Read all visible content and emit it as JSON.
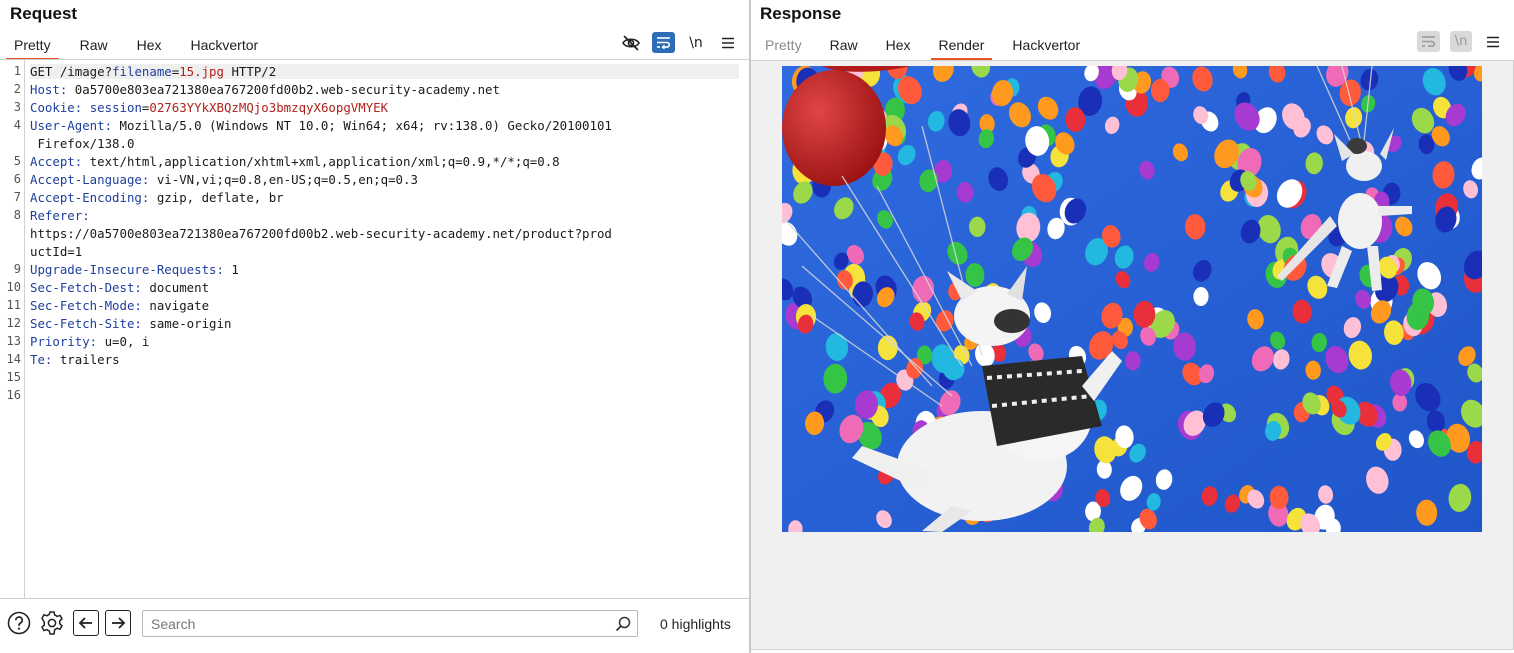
{
  "request": {
    "title": "Request",
    "tabs": [
      "Pretty",
      "Raw",
      "Hex",
      "Hackvertor"
    ],
    "active_tab": "Pretty",
    "icons": [
      "eye-off-icon",
      "wrap-lines-icon",
      "newline-icon",
      "menu-icon"
    ],
    "line_numbers": [
      "1",
      "2",
      "3",
      "4",
      "",
      "5",
      "6",
      "7",
      "8",
      "",
      "",
      "9",
      "10",
      "11",
      "12",
      "13",
      "14",
      "15",
      "16"
    ],
    "lines": [
      {
        "parts": [
          {
            "t": "GET /image?",
            "c": ""
          },
          {
            "t": "filename",
            "c": "k"
          },
          {
            "t": "=",
            "c": ""
          },
          {
            "t": "15.jpg",
            "c": "v"
          },
          {
            "t": " HTTP/2",
            "c": ""
          }
        ]
      },
      {
        "parts": [
          {
            "t": "Host:",
            "c": "k"
          },
          {
            "t": " 0a5700e803ea721380ea767200fd00b2.web-security-academy.net",
            "c": ""
          }
        ]
      },
      {
        "parts": [
          {
            "t": "Cookie:",
            "c": "k"
          },
          {
            "t": " ",
            "c": ""
          },
          {
            "t": "session",
            "c": "k"
          },
          {
            "t": "=",
            "c": ""
          },
          {
            "t": "02763YYkXBQzMQjo3bmzqyX6opgVMYEK",
            "c": "v"
          }
        ]
      },
      {
        "parts": [
          {
            "t": "User-Agent:",
            "c": "k"
          },
          {
            "t": " Mozilla/5.0 (Windows NT 10.0; Win64; x64; rv:138.0) Gecko/20100101",
            "c": ""
          }
        ]
      },
      {
        "parts": [
          {
            "t": " Firefox/138.0",
            "c": ""
          }
        ]
      },
      {
        "parts": [
          {
            "t": "Accept:",
            "c": "k"
          },
          {
            "t": " text/html,application/xhtml+xml,application/xml;q=0.9,*/*;q=0.8",
            "c": ""
          }
        ]
      },
      {
        "parts": [
          {
            "t": "Accept-Language:",
            "c": "k"
          },
          {
            "t": " vi-VN,vi;q=0.8,en-US;q=0.5,en;q=0.3",
            "c": ""
          }
        ]
      },
      {
        "parts": [
          {
            "t": "Accept-Encoding:",
            "c": "k"
          },
          {
            "t": " gzip, deflate, br",
            "c": ""
          }
        ]
      },
      {
        "parts": [
          {
            "t": "Referer:",
            "c": "k"
          }
        ]
      },
      {
        "parts": [
          {
            "t": "https://0a5700e803ea721380ea767200fd00b2.web-security-academy.net/product?prod",
            "c": ""
          }
        ]
      },
      {
        "parts": [
          {
            "t": "uctId=1",
            "c": ""
          }
        ]
      },
      {
        "parts": [
          {
            "t": "Upgrade-Insecure-Requests:",
            "c": "k"
          },
          {
            "t": " 1",
            "c": ""
          }
        ]
      },
      {
        "parts": [
          {
            "t": "Sec-Fetch-Dest:",
            "c": "k"
          },
          {
            "t": " document",
            "c": ""
          }
        ]
      },
      {
        "parts": [
          {
            "t": "Sec-Fetch-Mode:",
            "c": "k"
          },
          {
            "t": " navigate",
            "c": ""
          }
        ]
      },
      {
        "parts": [
          {
            "t": "Sec-Fetch-Site:",
            "c": "k"
          },
          {
            "t": " same-origin",
            "c": ""
          }
        ]
      },
      {
        "parts": [
          {
            "t": "Priority:",
            "c": "k"
          },
          {
            "t": " u=0, i",
            "c": ""
          }
        ]
      },
      {
        "parts": [
          {
            "t": "Te:",
            "c": "k"
          },
          {
            "t": " trailers",
            "c": ""
          }
        ]
      },
      {
        "parts": []
      },
      {
        "parts": []
      }
    ],
    "search": {
      "placeholder": "Search",
      "value": ""
    },
    "highlights": "0 highlights",
    "footer_icons": [
      "help-icon",
      "settings-icon",
      "back-arrow-icon",
      "forward-arrow-icon",
      "search-icon"
    ]
  },
  "response": {
    "title": "Response",
    "tabs": [
      "Pretty",
      "Raw",
      "Hex",
      "Render",
      "Hackvertor"
    ],
    "active_tab": "Render",
    "icons": [
      "wrap-lines-icon",
      "newline-icon",
      "menu-icon"
    ],
    "render_image": "dogs-floating-with-balloons-image"
  },
  "colors": {
    "accent": "#e8562a",
    "header_key": "#1f3f9e",
    "value": "#b0221b",
    "toggle_active": "#2e6cb5",
    "image_sky": "#2a63d8"
  }
}
